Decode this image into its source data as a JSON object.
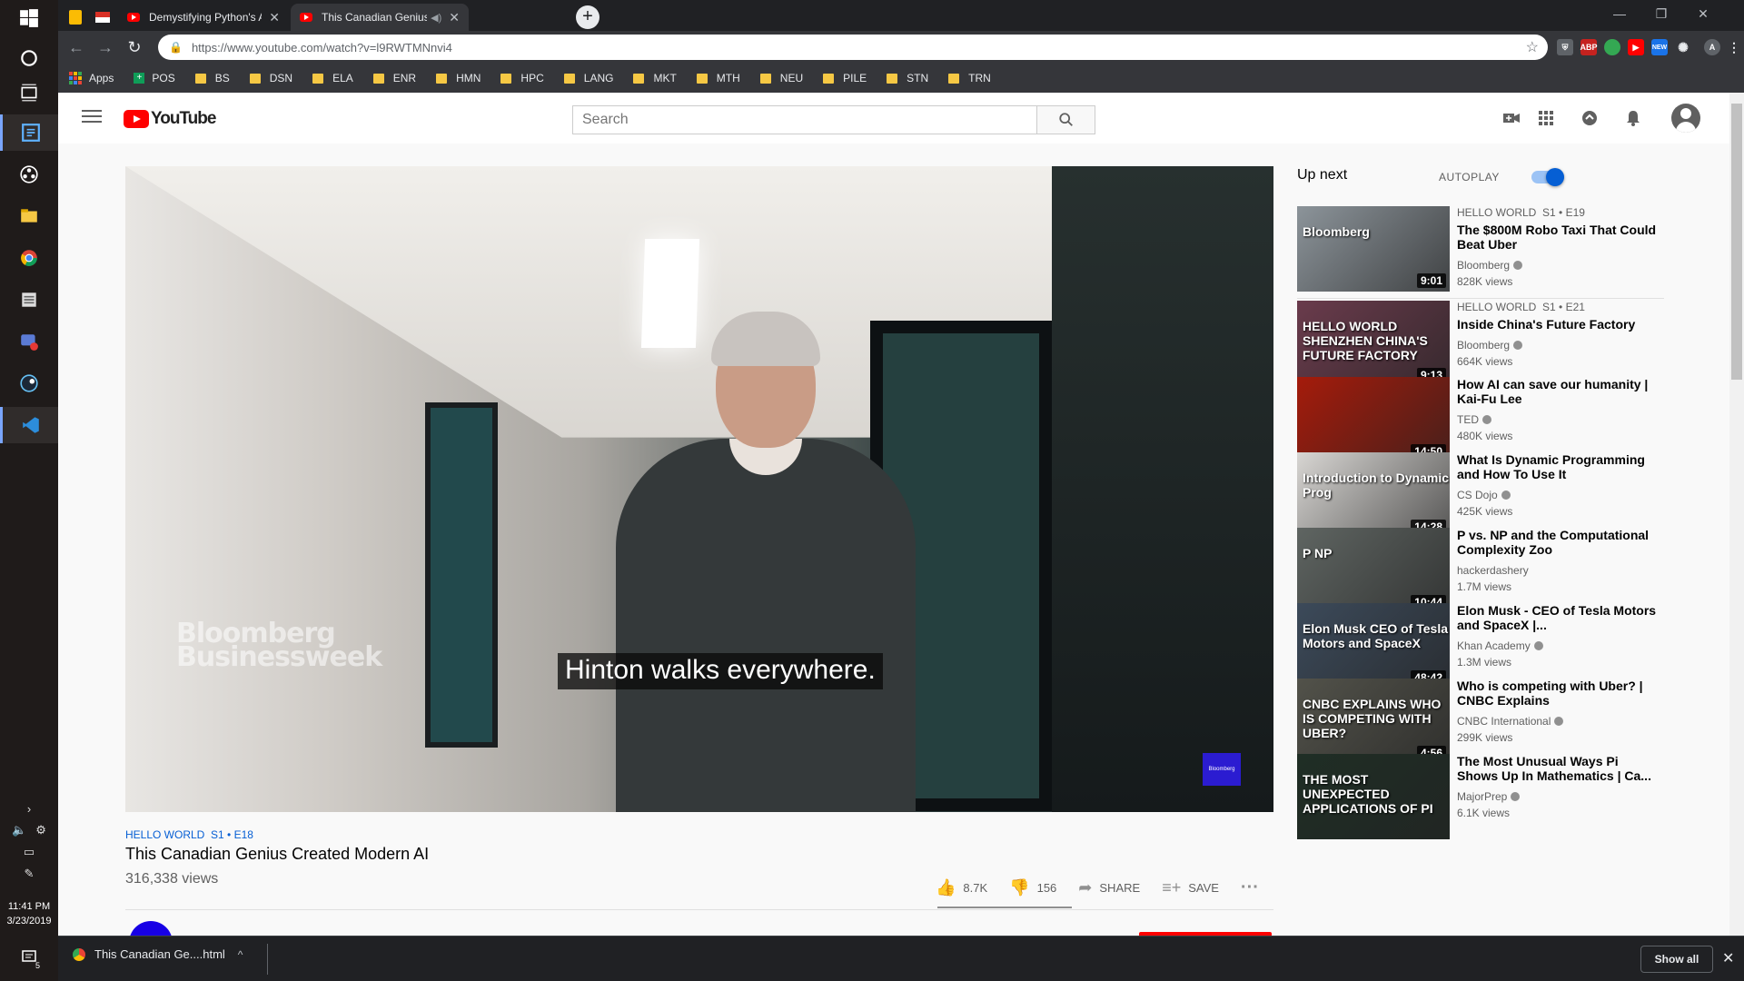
{
  "browser": {
    "tabs": [
      {
        "title": "Demystifying Python's Async and",
        "active": false
      },
      {
        "title": "This Canadian Genius Create",
        "active": true
      }
    ],
    "url": "https://www.youtube.com/watch?v=l9RWTMNnvi4",
    "bookmarks": [
      "Apps",
      "POS",
      "BS",
      "DSN",
      "ELA",
      "ENR",
      "HMN",
      "HPC",
      "LANG",
      "MKT",
      "MTH",
      "NEU",
      "PILE",
      "STN",
      "TRN"
    ],
    "extensions": [
      {
        "name": "new-badge",
        "text": "NEW"
      },
      {
        "name": "profile-avatar",
        "text": "A"
      }
    ]
  },
  "youtube": {
    "logo_text": "YouTube",
    "search_placeholder": "Search",
    "video": {
      "caption": "Hinton walks everywhere.",
      "watermark": "Bloomberg Businessweek",
      "badge": "Bloomberg",
      "series": "HELLO WORLD  S1 • E18",
      "title": "This Canadian Genius Created Modern AI",
      "views": "316,338 views",
      "likes": "8.7K",
      "dislikes": "156",
      "share_label": "SHARE",
      "save_label": "SAVE",
      "like_ratio": 0.98
    },
    "upnext": {
      "label": "Up next",
      "autoplay_label": "AUTOPLAY",
      "autoplay_on": true,
      "items": [
        {
          "series": "HELLO WORLD  S1 • E19",
          "title": "The $800M Robo Taxi That Could Beat Uber",
          "channel": "Bloomberg",
          "verified": true,
          "views": "828K views",
          "duration": "9:01",
          "thumb_text": "Bloomberg",
          "thumb_color": "#8c949a"
        },
        {
          "series": "HELLO WORLD  S1 • E21",
          "title": "Inside China's Future Factory",
          "channel": "Bloomberg",
          "verified": true,
          "views": "664K views",
          "duration": "9:13",
          "thumb_text": "HELLO WORLD SHENZHEN CHINA'S FUTURE FACTORY",
          "thumb_color": "#6a3b4c"
        },
        {
          "series": "",
          "title": "How AI can save our humanity | Kai-Fu Lee",
          "channel": "TED",
          "verified": true,
          "views": "480K views",
          "duration": "14:50",
          "thumb_text": "",
          "thumb_color": "#a51b0b"
        },
        {
          "series": "",
          "title": "What Is Dynamic Programming and How To Use It",
          "channel": "CS Dojo",
          "verified": true,
          "views": "425K views",
          "duration": "14:28",
          "thumb_text": "Introduction to Dynamic Prog",
          "thumb_color": "#d8d6d3"
        },
        {
          "series": "",
          "title": "P vs. NP and the Computational Complexity Zoo",
          "channel": "hackerdashery",
          "verified": false,
          "views": "1.7M views",
          "duration": "10:44",
          "thumb_text": "P  NP",
          "thumb_color": "#5f6562"
        },
        {
          "series": "",
          "title": "Elon Musk - CEO of Tesla Motors and SpaceX |...",
          "channel": "Khan Academy",
          "verified": true,
          "views": "1.3M views",
          "duration": "48:42",
          "thumb_text": "Elon Musk CEO of Tesla Motors and SpaceX",
          "thumb_color": "#3c4a5a"
        },
        {
          "series": "",
          "title": "Who is competing with Uber? | CNBC Explains",
          "channel": "CNBC International",
          "verified": true,
          "views": "299K views",
          "duration": "4:56",
          "thumb_text": "CNBC EXPLAINS WHO IS COMPETING WITH UBER?",
          "thumb_color": "#52524a"
        },
        {
          "series": "",
          "title": "The Most Unusual Ways Pi Shows Up In Mathematics | Ca...",
          "channel": "MajorPrep",
          "verified": true,
          "views": "6.1K views",
          "duration": "",
          "thumb_text": "THE MOST UNEXPECTED APPLICATIONS OF PI",
          "thumb_color": "#1f2e25"
        }
      ]
    }
  },
  "taskbar": {
    "time": "11:41 PM",
    "date": "3/23/2019",
    "notification_count": "5"
  },
  "downloads": {
    "file": "This Canadian Ge....html",
    "show_all_label": "Show all"
  },
  "colors": {
    "youtube_red": "#ff0000",
    "link_blue": "#065fd4",
    "chrome_dark": "#35363a"
  }
}
